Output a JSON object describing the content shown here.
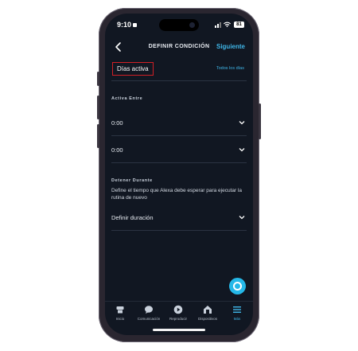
{
  "status": {
    "time": "9:10",
    "battery": "81"
  },
  "header": {
    "title": "DEFINIR CONDICIÓN",
    "next_label": "Siguiente"
  },
  "days": {
    "label": "Días activa",
    "link": "Todos los días"
  },
  "active_between": {
    "title": "Activa Entre",
    "start": "0:00",
    "end": "0:00"
  },
  "stop_during": {
    "title": "Detener Durante",
    "description": "Define el tiempo que Alexa debe esperar para ejecutar la rutina de nuevo",
    "select_label": "Definir duración"
  },
  "tabs": [
    {
      "label": "Inicio",
      "icon": "home-icon"
    },
    {
      "label": "Comunicación",
      "icon": "chat-bubble-icon"
    },
    {
      "label": "Reproducir",
      "icon": "play-icon"
    },
    {
      "label": "Dispositivos",
      "icon": "devices-icon"
    },
    {
      "label": "Más",
      "icon": "menu-icon",
      "active": true
    }
  ],
  "colors": {
    "accent": "#3fb6e8",
    "background": "#111722",
    "highlight_border": "#d11f25",
    "fab": "#25b8e8"
  }
}
